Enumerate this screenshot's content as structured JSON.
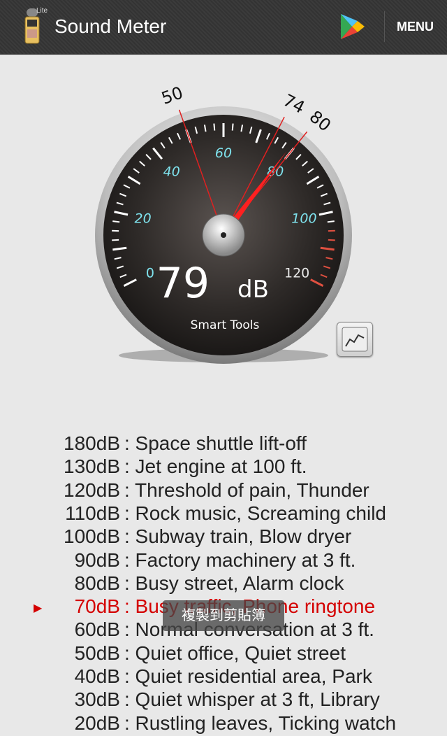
{
  "app": {
    "title": "Sound Meter",
    "badge": "Lite",
    "menu_label": "MENU"
  },
  "gauge": {
    "reading_value": "79",
    "reading_unit": "dB",
    "brand": "Smart Tools",
    "scale_labels": [
      "0",
      "20",
      "40",
      "60",
      "80",
      "100",
      "120"
    ],
    "markers": [
      "50",
      "74",
      "80"
    ],
    "current_db": 79,
    "min_db": 50,
    "avg_db": 74,
    "max_db": 80
  },
  "levels": [
    {
      "db": "180dB",
      "desc": ": Space shuttle lift-off"
    },
    {
      "db": "130dB",
      "desc": ": Jet engine at 100 ft."
    },
    {
      "db": "120dB",
      "desc": ": Threshold of pain, Thunder"
    },
    {
      "db": "110dB",
      "desc": ": Rock music, Screaming child"
    },
    {
      "db": "100dB",
      "desc": ": Subway train, Blow dryer"
    },
    {
      "db": "90dB",
      "desc": ": Factory machinery at 3 ft."
    },
    {
      "db": "80dB",
      "desc": ": Busy street, Alarm clock"
    },
    {
      "db": "70dB",
      "desc": ": Busy traffic, Phone ringtone",
      "active": true
    },
    {
      "db": "60dB",
      "desc": ": Normal conversation at 3 ft."
    },
    {
      "db": "50dB",
      "desc": ": Quiet office, Quiet street"
    },
    {
      "db": "40dB",
      "desc": ": Quiet residential area, Park"
    },
    {
      "db": "30dB",
      "desc": ": Quiet whisper at 3 ft, Library"
    },
    {
      "db": "20dB",
      "desc": ": Rustling leaves, Ticking watch"
    }
  ],
  "toast": {
    "text": "複製到剪貼簿"
  },
  "colors": {
    "accent": "#d40000",
    "scale_cyan": "#7fe3ee",
    "needle": "#ff2020"
  },
  "icons": {
    "app": "sound-meter-app-icon",
    "store": "play-store-icon",
    "graph": "line-graph-icon"
  }
}
